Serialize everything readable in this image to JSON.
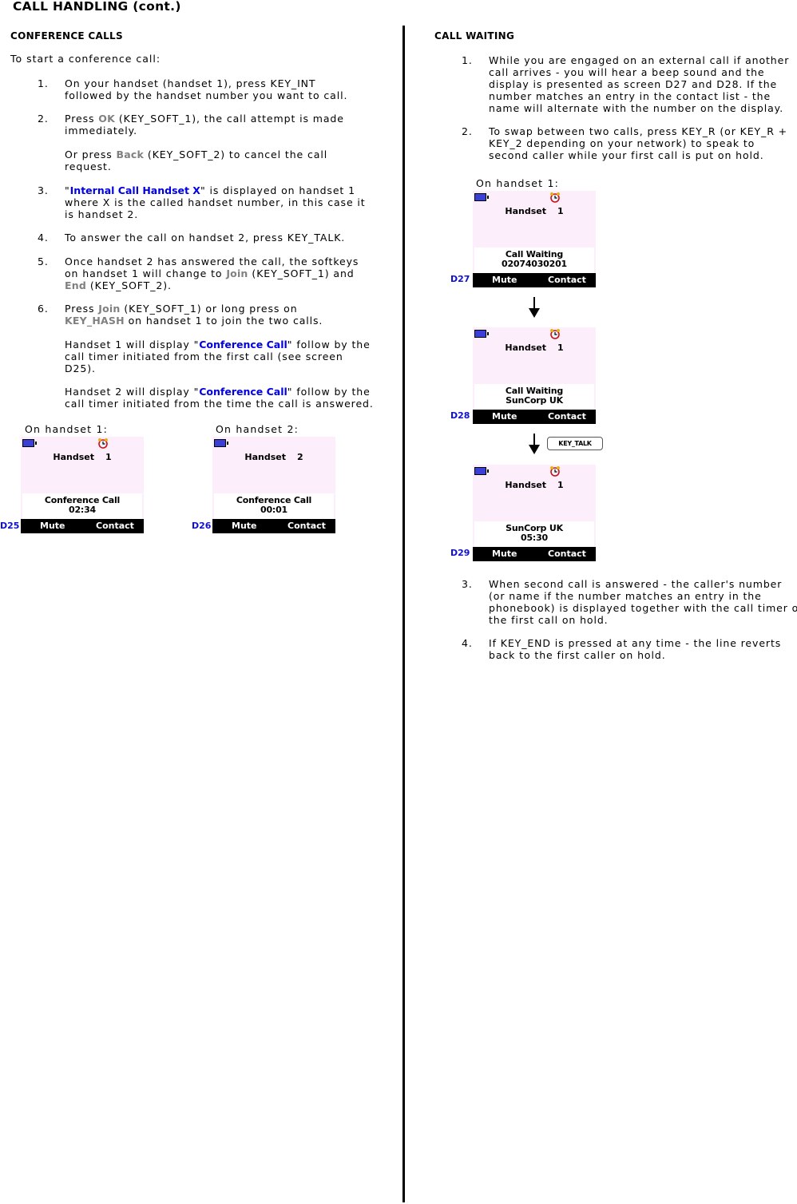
{
  "page_title": "CALL HANDLING (cont.)",
  "conference": {
    "title": "CONFERENCE CALLS",
    "intro": "To start a conference call:",
    "steps": [
      {
        "num": "1.",
        "lines": [
          "On your handset (handset 1), press KEY_INT",
          "followed by the handset number you want to call."
        ]
      },
      {
        "num": "2.",
        "line1_pre": "Press ",
        "line1_key": "OK",
        "line1_post": " (KEY_SOFT_1), the call attempt is made",
        "line2": "immediately."
      },
      {
        "num": "",
        "line1_pre": "Or press ",
        "line1_key": "Back",
        "line1_post": " (KEY_SOFT_2) to cancel the call",
        "line2": "request."
      },
      {
        "num": "3.",
        "q_open": "\"",
        "highlight": "Internal Call Handset X",
        "line1_post": "\" is displayed on handset 1",
        "line2": "where X is the called handset number, in this case it",
        "line3": "is handset 2."
      },
      {
        "num": "4.",
        "lines": [
          "To answer the call on handset 2, press KEY_TALK."
        ]
      },
      {
        "num": "5.",
        "line1": "Once handset 2 has answered the call, the softkeys",
        "line2_pre": "on handset 1 will change to ",
        "line2_key": "Join",
        "line2_post": " (KEY_SOFT_1) and",
        "line3_key": "End",
        "line3_post": " (KEY_SOFT_2)."
      },
      {
        "num": "6.",
        "line1_pre": "Press ",
        "line1_key": "Join",
        "line1_post": " (KEY_SOFT_1) or long press on",
        "line2_key": "KEY_HASH",
        "line2_post": " on handset 1 to join the two calls."
      },
      {
        "num": "",
        "line1_pre": "Handset 1 will display \"",
        "highlight": "Conference Call",
        "line1_post": "\" follow by the",
        "line2": "call timer initiated from the first call (see screen",
        "line3": "D25)."
      },
      {
        "num": "",
        "line1_pre": "Handset 2 will display \"",
        "highlight": "Conference Call",
        "line1_post": "\" follow by the",
        "line2": "call timer initiated from the time the call is answered."
      }
    ],
    "screens": [
      {
        "label": "On handset 1:",
        "id": "D25",
        "handset_label": "Handset",
        "handset_num": "1",
        "alarm": true,
        "info_line1": "Conference Call",
        "info_line2": "02:34",
        "softkey1": "Mute",
        "softkey2": "Contact"
      },
      {
        "label": "On handset 2:",
        "id": "D26",
        "handset_label": "Handset",
        "handset_num": "2",
        "alarm": false,
        "info_line1": "Conference Call",
        "info_line2": "00:01",
        "softkey1": "Mute",
        "softkey2": "Contact"
      }
    ]
  },
  "call_waiting": {
    "title": "CALL WAITING",
    "steps_top": [
      {
        "num": "1.",
        "lines": [
          "While you are engaged on an external call if another",
          "call arrives - you will hear a beep sound and the",
          "display is presented as screen D27 and D28. If the",
          "number matches an entry in the contact list - the",
          "name will alternate with the number on the display."
        ]
      },
      {
        "num": "2.",
        "lines": [
          "To swap between two calls, press KEY_R (or KEY_R +",
          "KEY_2 depending on your network) to speak to",
          "second caller while your first call is put on hold."
        ]
      }
    ],
    "on_label": "On handset 1:",
    "screens": [
      {
        "id": "D27",
        "handset_label": "Handset",
        "handset_num": "1",
        "info_line1": "Call Waiting",
        "info_line2": "02074030201",
        "softkey1": "Mute",
        "softkey2": "Contact"
      },
      {
        "id": "D28",
        "handset_label": "Handset",
        "handset_num": "1",
        "info_line1": "Call Waiting",
        "info_line2": "SunCorp UK",
        "softkey1": "Mute",
        "softkey2": "Contact"
      },
      {
        "id": "D29",
        "handset_label": "Handset",
        "handset_num": "1",
        "info_line1": "SunCorp UK",
        "info_line2": "05:30",
        "softkey1": "Mute",
        "softkey2": "Contact"
      }
    ],
    "key_badge": "KEY_TALK",
    "steps_bottom": [
      {
        "num": "3.",
        "lines": [
          "When second call is answered - the caller's number",
          "(or name if the number matches an entry in the",
          "phonebook) is displayed together with the call timer of",
          "the first call on hold."
        ]
      },
      {
        "num": "4.",
        "lines": [
          "If KEY_END is pressed at any time - the line reverts",
          "back to the first caller on hold."
        ]
      }
    ]
  },
  "colors": {
    "key_gray": "#808080",
    "highlight_blue": "#0000e0",
    "screen_bg": "#fdeefb",
    "screen_id_blue": "#1010d0"
  }
}
